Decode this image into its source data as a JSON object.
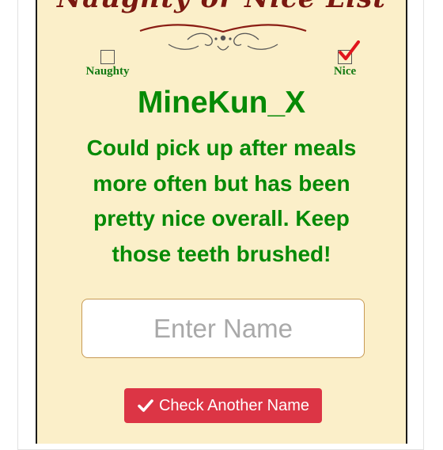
{
  "list": {
    "title": "Naughty or Nice List"
  },
  "options": {
    "naughty": {
      "label": "Naughty",
      "checked": false
    },
    "nice": {
      "label": "Nice",
      "checked": true
    }
  },
  "result": {
    "name": "MineKun_X",
    "message": "Could pick up after meals more often but has been pretty nice overall. Keep those teeth brushed!"
  },
  "form": {
    "name_placeholder": "Enter Name",
    "name_value": "",
    "submit_label": "Check Another Name"
  },
  "colors": {
    "scroll_background": "#fbefc9",
    "title_red": "#7a1810",
    "text_green": "#068a06",
    "button_red": "#dc3545",
    "check_red": "#e0151d"
  }
}
